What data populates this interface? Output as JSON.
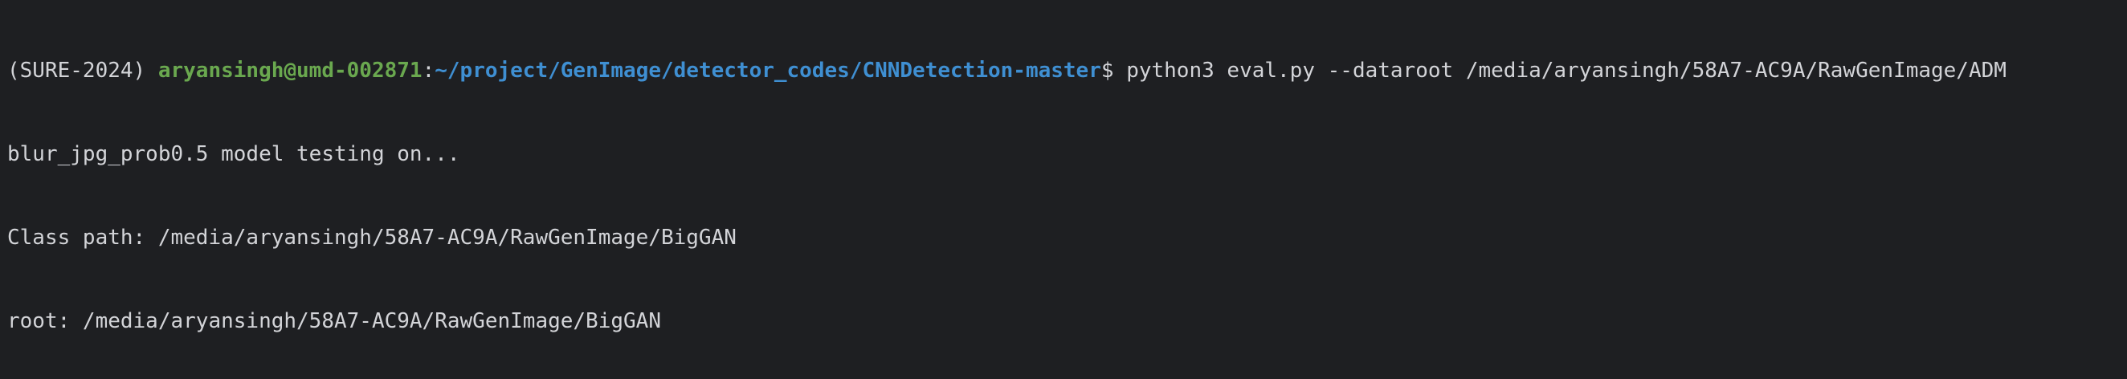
{
  "terminal": {
    "prompt": {
      "env": "(SURE-2024)",
      "user_host": "aryansingh@umd-002871",
      "separator": ":",
      "cwd": "~/project/GenImage/detector_codes/CNNDetection-master",
      "symbol": "$",
      "command": "python3 eval.py --dataroot /media/aryansingh/58A7-AC9A/RawGenImage/ADM"
    },
    "output": [
      "blur_jpg_prob0.5 model testing on...",
      "Class path: /media/aryansingh/58A7-AC9A/RawGenImage/BigGAN",
      "root: /media/aryansingh/58A7-AC9A/RawGenImage/BigGAN"
    ],
    "colors": {
      "background": "#1e1f22",
      "text": "#d3d4d8",
      "user_host": "#6aa84f",
      "path": "#3f8fd2"
    }
  }
}
